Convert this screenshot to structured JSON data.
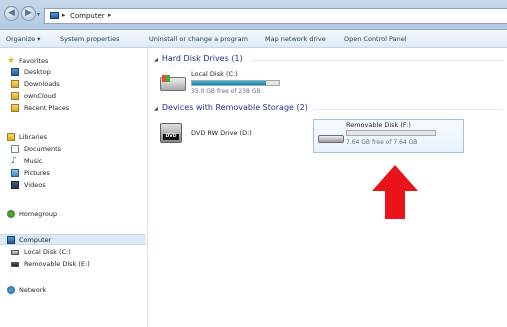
{
  "address": {
    "breadcrumb": "Computer"
  },
  "toolbar": {
    "items": [
      "Organize ▾",
      "System properties",
      "Uninstall or change a program",
      "Map network drive",
      "Open Control Panel"
    ]
  },
  "sidebar": {
    "favorites_label": "Favorites",
    "favorites": [
      "Desktop",
      "Downloads",
      "ownCloud",
      "Recent Places"
    ],
    "libraries_label": "Libraries",
    "libraries": [
      "Documents",
      "Music",
      "Pictures",
      "Videos"
    ],
    "homegroup_label": "Homegroup",
    "computer_label": "Computer",
    "computer_children": [
      "Local Disk (C:)",
      "Removable Disk (E:)"
    ],
    "network_label": "Network"
  },
  "content": {
    "hdd_group": "Hard Disk Drives (1)",
    "removable_group": "Devices with Removable Storage (2)",
    "local_disk": {
      "name": "Local Disk (C:)",
      "free_text": "35.0 GB free of 238 GB",
      "used_fraction": 0.853
    },
    "dvd": {
      "name": "DVD RW Drive (D:)",
      "badge": "DVD"
    },
    "removable_disk": {
      "name": "Removable Disk (F:)",
      "free_text": "7.64 GB free of 7.64 GB",
      "used_fraction": 0.0
    }
  },
  "colors": {
    "accent_red_arrow": "#e8141a",
    "selection": "#dce9f7",
    "group_title": "#1e3287",
    "bar_fill": "#26a0c8"
  }
}
